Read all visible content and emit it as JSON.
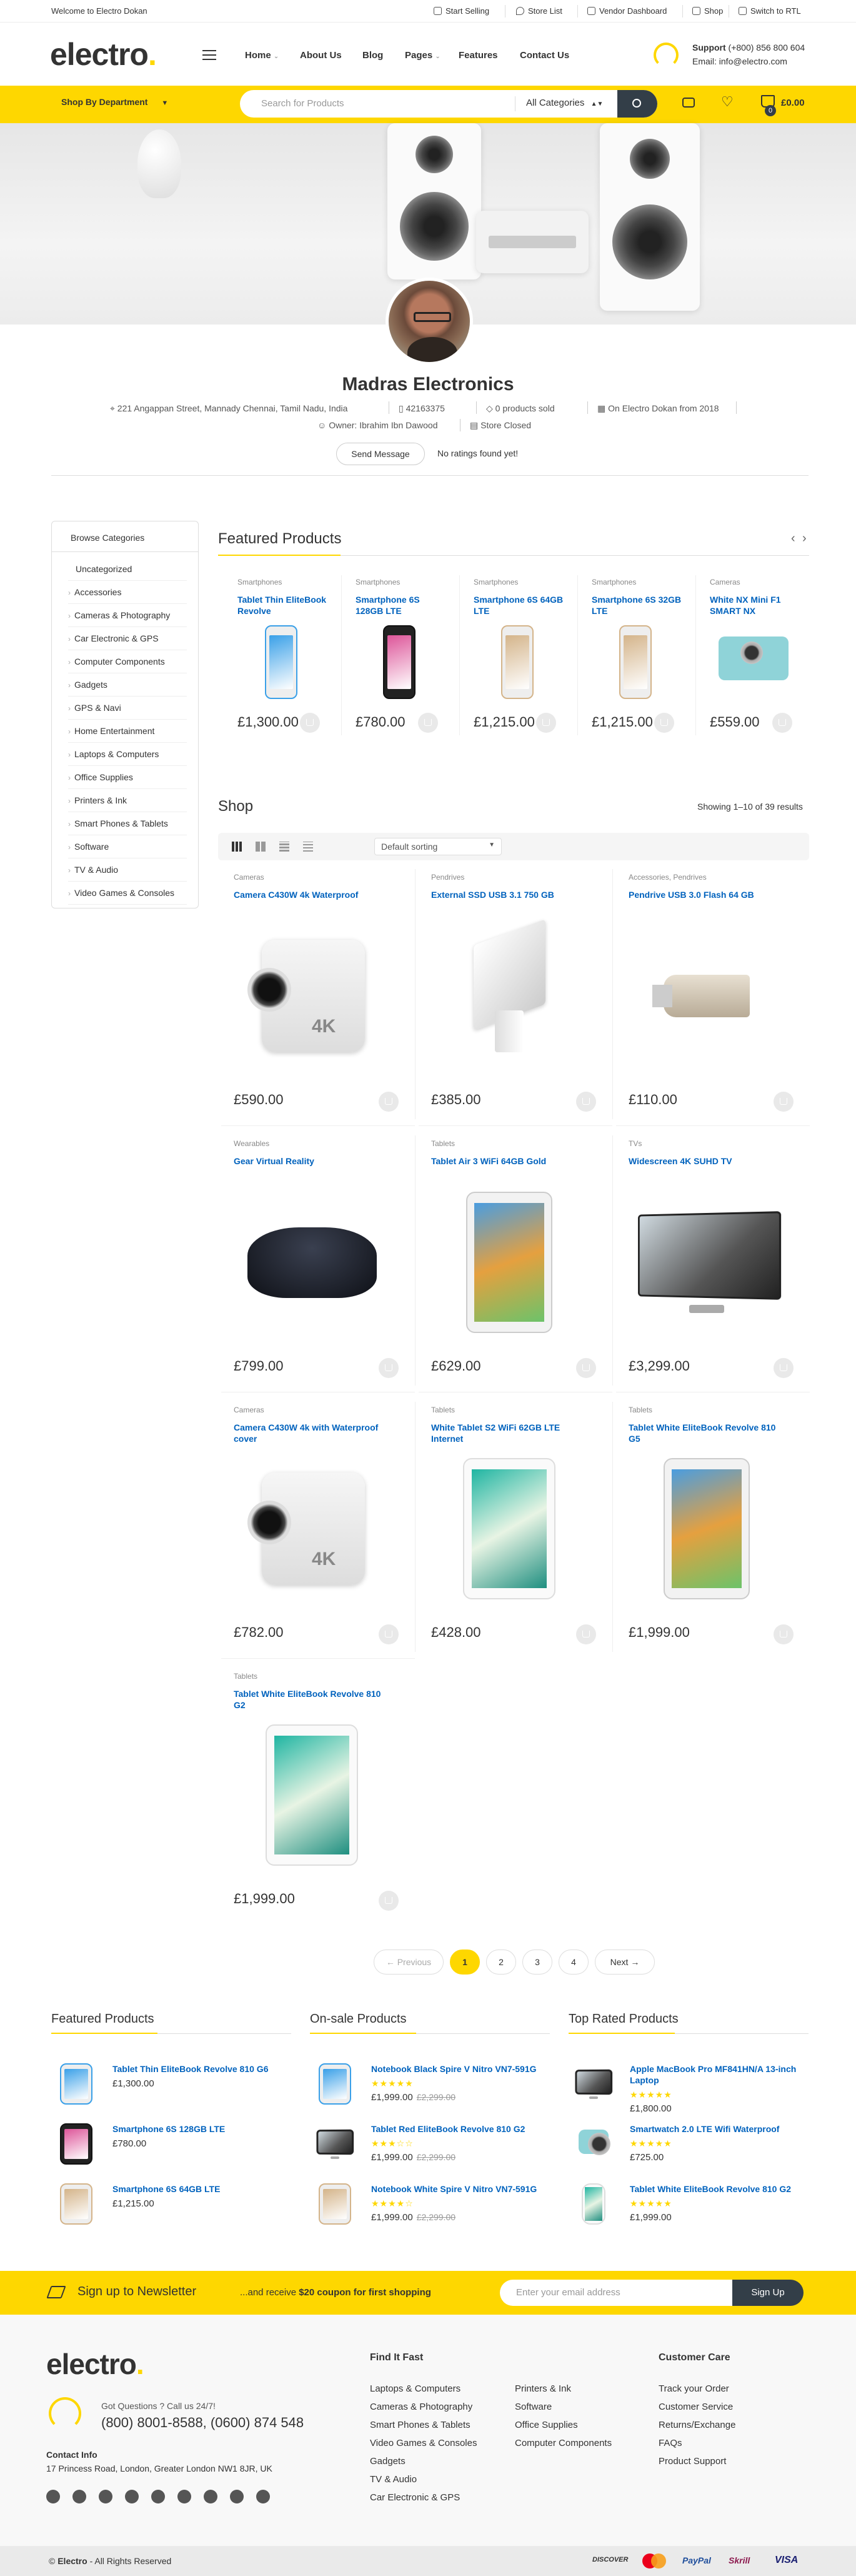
{
  "topbar": {
    "welcome": "Welcome to Electro Dokan",
    "links": [
      "Start Selling",
      "Store List",
      "Vendor Dashboard",
      "Shop",
      "Switch to RTL"
    ]
  },
  "header": {
    "logo": "electro",
    "nav": [
      "Home",
      "About Us",
      "Blog",
      "Pages",
      "Features",
      "Contact Us"
    ],
    "support_title": "Support",
    "support_phone": "(+800) 856 800 604",
    "support_email": "Email: info@electro.com"
  },
  "searchbar": {
    "shop_by_department": "Shop By Department",
    "placeholder": "Search for Products",
    "category": "All Categories",
    "cart_total": "£0.00",
    "cart_count": "0"
  },
  "store": {
    "name": "Madras Electronics",
    "address": "221 Angappan Street, Mannady Chennai, Tamil Nadu, India",
    "phone": "42163375",
    "sold": "0 products sold",
    "since": "On Electro Dokan from 2018",
    "owner": "Owner: Ibrahim Ibn Dawood",
    "status": "Store Closed",
    "send_message": "Send Message",
    "ratings": "No ratings found yet!"
  },
  "sidebar": {
    "title": "Browse Categories",
    "items": [
      "Uncategorized",
      "Accessories",
      "Cameras & Photography",
      "Car Electronic & GPS",
      "Computer Components",
      "Gadgets",
      "GPS & Navi",
      "Home Entertainment",
      "Laptops & Computers",
      "Office Supplies",
      "Printers & Ink",
      "Smart Phones & Tablets",
      "Software",
      "TV & Audio",
      "Video Games & Consoles"
    ]
  },
  "featured": {
    "title": "Featured Products",
    "products": [
      {
        "cat": "Smartphones",
        "name": "Tablet Thin EliteBook Revolve",
        "price": "£1,300.00"
      },
      {
        "cat": "Smartphones",
        "name": "Smartphone 6S 128GB LTE",
        "price": "£780.00"
      },
      {
        "cat": "Smartphones",
        "name": "Smartphone 6S 64GB LTE",
        "price": "£1,215.00"
      },
      {
        "cat": "Smartphones",
        "name": "Smartphone 6S 32GB LTE",
        "price": "£1,215.00"
      },
      {
        "cat": "Cameras",
        "name": "White NX Mini F1 SMART NX",
        "price": "£559.00"
      }
    ]
  },
  "shop": {
    "title": "Shop",
    "results": "Showing 1–10 of 39 results",
    "sorting": "Default sorting",
    "products": [
      {
        "cat": "Cameras",
        "name": "Camera C430W 4k Waterproof",
        "price": "£590.00"
      },
      {
        "cat": "Pendrives",
        "name": "External SSD USB 3.1 750 GB",
        "price": "£385.00"
      },
      {
        "cat": "Accessories, Pendrives",
        "name": "Pendrive USB 3.0 Flash 64 GB",
        "price": "£110.00"
      },
      {
        "cat": "Wearables",
        "name": "Gear Virtual Reality",
        "price": "£799.00"
      },
      {
        "cat": "Tablets",
        "name": "Tablet Air 3 WiFi 64GB Gold",
        "price": "£629.00"
      },
      {
        "cat": "TVs",
        "name": "Widescreen 4K SUHD TV",
        "price": "£3,299.00"
      },
      {
        "cat": "Cameras",
        "name": "Camera C430W 4k with Waterproof cover",
        "price": "£782.00"
      },
      {
        "cat": "Tablets",
        "name": "White Tablet S2 WiFi 62GB LTE Internet",
        "price": "£428.00"
      },
      {
        "cat": "Tablets",
        "name": "Tablet White EliteBook Revolve 810 G5",
        "price": "£1,999.00"
      },
      {
        "cat": "Tablets",
        "name": "Tablet White EliteBook Revolve 810 G2",
        "price": "£1,999.00"
      }
    ],
    "pagination": {
      "prev": "← Previous",
      "pages": [
        "1",
        "2",
        "3",
        "4"
      ],
      "next": "Next →"
    }
  },
  "bottom_lists": {
    "featured": {
      "title": "Featured Products",
      "items": [
        {
          "name": "Tablet Thin EliteBook Revolve 810 G6",
          "price": "£1,300.00"
        },
        {
          "name": "Smartphone 6S 128GB LTE",
          "price": "£780.00"
        },
        {
          "name": "Smartphone 6S 64GB LTE",
          "price": "£1,215.00"
        }
      ]
    },
    "onsale": {
      "title": "On-sale Products",
      "items": [
        {
          "name": "Notebook Black Spire V Nitro VN7-591G",
          "price": "£1,999.00",
          "old": "£2,299.00",
          "stars": "★★★★★"
        },
        {
          "name": "Tablet Red EliteBook Revolve 810 G2",
          "price": "£1,999.00",
          "old": "£2,299.00",
          "stars": "★★★☆☆"
        },
        {
          "name": "Notebook White Spire V Nitro VN7-591G",
          "price": "£1,999.00",
          "old": "£2,299.00",
          "stars": "★★★★☆"
        }
      ]
    },
    "toprated": {
      "title": "Top Rated Products",
      "items": [
        {
          "name": "Apple MacBook Pro MF841HN/A 13-inch Laptop",
          "price": "£1,800.00",
          "stars": "★★★★★"
        },
        {
          "name": "Smartwatch 2.0 LTE Wifi Waterproof",
          "price": "£725.00",
          "stars": "★★★★★"
        },
        {
          "name": "Tablet White EliteBook Revolve 810 G2",
          "price": "£1,999.00",
          "stars": "★★★★★"
        }
      ]
    }
  },
  "newsletter": {
    "title": "Sign up to Newsletter",
    "text_pre": "...and receive ",
    "text_bold": "$20 coupon for first shopping",
    "placeholder": "Enter your email address",
    "button": "Sign Up"
  },
  "footer": {
    "logo": "electro",
    "questions": "Got Questions ? Call us 24/7!",
    "phones": "(800) 8001-8588, (0600) 874 548",
    "contact_title": "Contact Info",
    "address": "17 Princess Road, London, Greater London NW1 8JR, UK",
    "find_title": "Find It Fast",
    "find_col1": [
      "Laptops & Computers",
      "Cameras & Photography",
      "Smart Phones & Tablets",
      "Video Games & Consoles",
      "Gadgets",
      "TV & Audio",
      "Car Electronic & GPS"
    ],
    "find_col2": [
      "Printers & Ink",
      "Software",
      "Office Supplies",
      "Computer Components"
    ],
    "care_title": "Customer Care",
    "care": [
      "Track your Order",
      "Customer Service",
      "Returns/Exchange",
      "FAQs",
      "Product Support"
    ],
    "copyright_bold": "Electro",
    "copyright": " - All Rights Reserved",
    "payments": [
      "DISCOVER",
      "mastercard",
      "PayPal",
      "Skrill",
      "VISA"
    ]
  }
}
